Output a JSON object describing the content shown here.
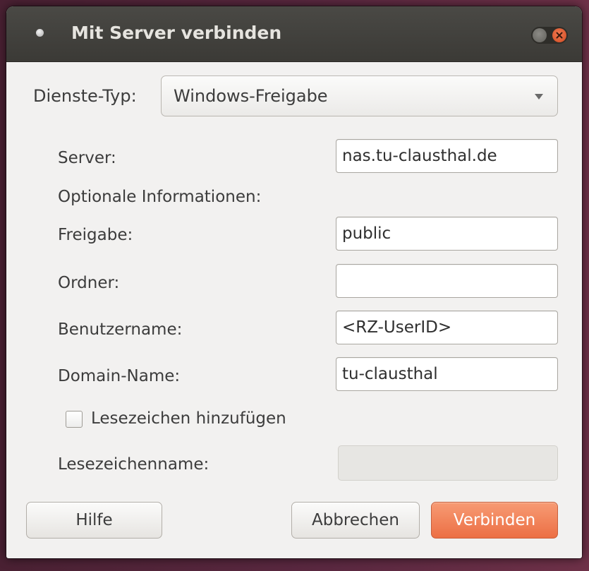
{
  "window": {
    "title": "Mit Server verbinden"
  },
  "service_type": {
    "label": "Dienste-Typ:",
    "value": "Windows-Freigabe"
  },
  "form": {
    "server": {
      "label": "Server:",
      "value": "nas.tu-clausthal.de"
    },
    "optional_heading": "Optionale Informationen:",
    "share": {
      "label": "Freigabe:",
      "value": "public"
    },
    "folder": {
      "label": "Ordner:",
      "value": ""
    },
    "username": {
      "label": "Benutzername:",
      "value": "<RZ-UserID>"
    },
    "domain": {
      "label": "Domain-Name:",
      "value": "tu-clausthal"
    },
    "bookmark_checkbox": {
      "label": "Lesezeichen hinzufügen",
      "checked": false
    },
    "bookmark_name": {
      "label": "Lesezeichenname:",
      "value": "",
      "enabled": false
    }
  },
  "buttons": {
    "help": "Hilfe",
    "cancel": "Abbrechen",
    "connect": "Verbinden"
  },
  "colors": {
    "accent": "#ee7547",
    "titlebar": "#3c3b37",
    "window_bg": "#f2f1f0",
    "close": "#e05a2c"
  }
}
